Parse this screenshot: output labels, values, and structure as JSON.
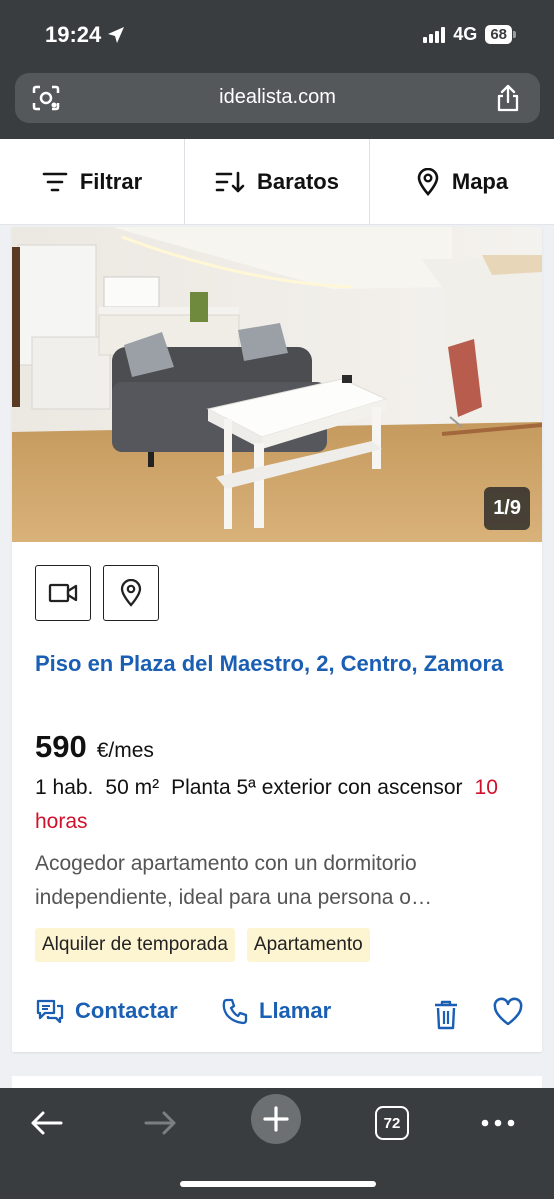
{
  "status_bar": {
    "time": "19:24",
    "network": "4G",
    "battery": "68"
  },
  "browser": {
    "url": "idealista.com",
    "tabs_count": "72"
  },
  "toolbar": {
    "filter_label": "Filtrar",
    "sort_label": "Baratos",
    "map_label": "Mapa"
  },
  "listing": {
    "photo_counter": "1/9",
    "title": "Piso en Plaza del Maestro, 2, Centro, Zamora",
    "price": "590",
    "price_unit": "€/mes",
    "rooms": "1 hab.",
    "area": "50 m²",
    "floor": "Planta 5ª exterior con ascensor",
    "posted": "10 horas",
    "description": "Acogedor apartamento con un dormitorio independiente, ideal para una persona o…",
    "tags": [
      "Alquiler de temporada",
      "Apartamento"
    ],
    "contact_label": "Contactar",
    "call_label": "Llamar"
  },
  "colors": {
    "link_blue": "#1a5fb4",
    "time_red": "#d0112b",
    "tag_bg": "#fdf5d2",
    "chrome": "#3a3d40"
  }
}
